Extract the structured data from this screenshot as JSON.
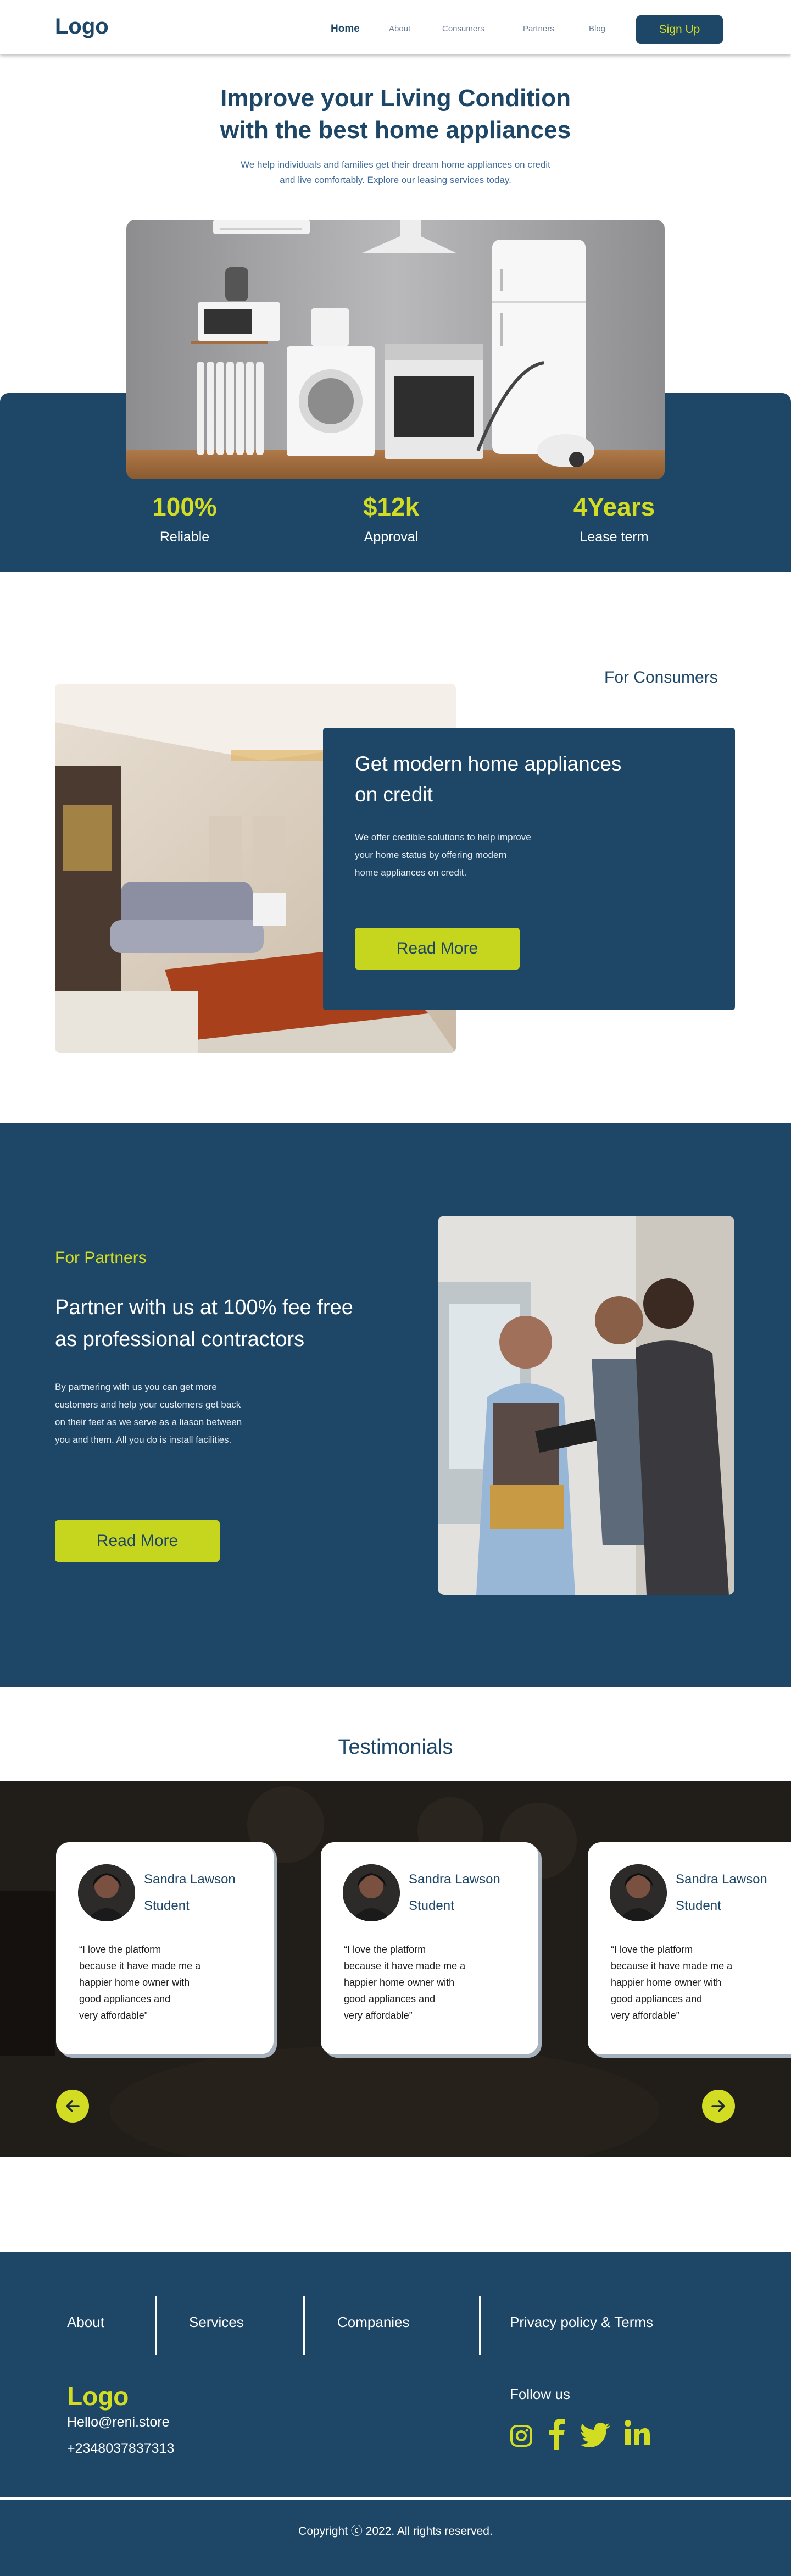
{
  "header": {
    "logo": "Logo",
    "nav": [
      "Home",
      "About",
      "Consumers",
      "Partners",
      "Blog"
    ],
    "signup": "Sign Up"
  },
  "hero": {
    "title_line1": "Improve your Living Condition",
    "title_line2": "with the best home appliances",
    "subtitle_line1": "We help individuals and families get their dream home appliances on credit",
    "subtitle_line2": "and live comfortably. Explore our leasing services today.",
    "stats": [
      {
        "value": "100%",
        "label": "Reliable"
      },
      {
        "value": "$12k",
        "label": "Approval"
      },
      {
        "value": "4Years",
        "label": "Lease term"
      }
    ]
  },
  "consumers": {
    "tag": "For Consumers",
    "title_line1": "Get modern home appliances",
    "title_line2": "on credit",
    "body_lines": [
      "We offer credible solutions to help improve",
      "your home status by offering modern",
      "home appliances on credit."
    ],
    "button": "Read More"
  },
  "partners": {
    "tag": "For Partners",
    "title_line1": "Partner with us at 100% fee free",
    "title_line2": "as professional contractors",
    "body_lines": [
      "By partnering with us you can get more",
      "customers and help your customers get back",
      "on their feet as we serve as a liason between",
      "you and them. All you do is install facilities."
    ],
    "button": "Read More"
  },
  "testimonials": {
    "title": "Testimonials",
    "cards": [
      {
        "name": "Sandra Lawson",
        "role": "Student",
        "quote_lines": [
          "“I love the platform",
          "because it have made me a",
          "happier home owner with",
          "good appliances and",
          "very affordable”"
        ]
      },
      {
        "name": "Sandra Lawson",
        "role": "Student",
        "quote_lines": [
          "“I love the platform",
          "because it have made me a",
          "happier home owner with",
          "good appliances and",
          "very affordable”"
        ]
      },
      {
        "name": "Sandra Lawson",
        "role": "Student",
        "quote_lines": [
          "“I love the platform",
          "because it have made me a",
          "happier home owner with",
          "good appliances and",
          "very affordable”"
        ]
      }
    ]
  },
  "footer": {
    "links": [
      "About",
      "Services",
      "Companies",
      "Privacy policy & Terms"
    ],
    "logo": "Logo",
    "email": "Hello@reni.store",
    "phone": "+2348037837313",
    "follow": "Follow us",
    "social_icons": [
      "instagram-icon",
      "facebook-icon",
      "twitter-icon",
      "linkedin-icon"
    ],
    "copyright": "Copyright ⓒ 2022.   All rights reserved."
  },
  "colors": {
    "navy": "#1d4667",
    "lime": "#d1dc22"
  }
}
